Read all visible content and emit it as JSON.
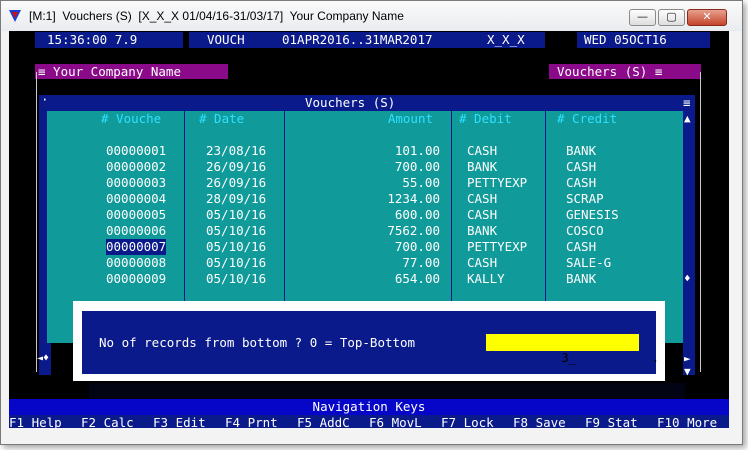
{
  "window": {
    "title": "[M:1]  Vouchers (S)  [X_X_X 01/04/16-31/03/17]  Your Company Name",
    "minimize_glyph": "—",
    "maximize_glyph": "▢",
    "close_glyph": "✕"
  },
  "status_bar": {
    "clock": "15:36:00 7.9",
    "module": "VOUCH",
    "period": "01APR2016..31MAR2017",
    "code": "X_X_X",
    "date": "WED 05OCT16"
  },
  "company_tab": "≡ Your Company Name",
  "view_tab": "Vouchers (S) ≡",
  "grid": {
    "title": "Vouchers (S)",
    "left_marker": "·",
    "right_marker": "≡",
    "columns": [
      "# Vouche",
      "# Date",
      "Amount",
      "# Debit",
      "# Credit"
    ],
    "rows": [
      [
        "00000001",
        "23/08/16",
        "101.00",
        "CASH",
        "BANK"
      ],
      [
        "00000002",
        "26/09/16",
        "700.00",
        "BANK",
        "CASH"
      ],
      [
        "00000003",
        "26/09/16",
        "55.00",
        "PETTYEXP",
        "CASH"
      ],
      [
        "00000004",
        "28/09/16",
        "1234.00",
        "CASH",
        "SCRAP"
      ],
      [
        "00000005",
        "05/10/16",
        "600.00",
        "CASH",
        "GENESIS"
      ],
      [
        "00000006",
        "05/10/16",
        "7562.00",
        "BANK",
        "COSCO"
      ],
      [
        "00000007",
        "05/10/16",
        "700.00",
        "PETTYEXP",
        "CASH"
      ],
      [
        "00000008",
        "05/10/16",
        "77.00",
        "CASH",
        "SALE-G"
      ],
      [
        "00000009",
        "05/10/16",
        "654.00",
        "KALLY",
        "BANK"
      ]
    ],
    "selected_row": 6,
    "scroll_up": "▲",
    "scroll_down": "▼",
    "scroll_thumb": "♦",
    "scroll_left": "◄♦",
    "scroll_right": "►"
  },
  "dialog": {
    "prompt": "No of records from bottom ? 0 = Top-Bottom",
    "input_value": "3",
    "input_mask": "_          ."
  },
  "nav": {
    "title": "Navigation Keys",
    "keys": [
      {
        "key": "F1",
        "label": "Help"
      },
      {
        "key": "F2",
        "label": "Calc"
      },
      {
        "key": "F3",
        "label": "Edit"
      },
      {
        "key": "F4",
        "label": "Prnt"
      },
      {
        "key": "F5",
        "label": "AddC"
      },
      {
        "key": "F6",
        "label": "MovL"
      },
      {
        "key": "F7",
        "label": "Lock"
      },
      {
        "key": "F8",
        "label": "Save"
      },
      {
        "key": "F9",
        "label": "Stat"
      },
      {
        "key": "F10",
        "label": "More"
      }
    ]
  },
  "colors": {
    "navy": "#0a1a8a",
    "teal": "#119a9a",
    "purple": "#8a0a8a",
    "header_text": "#2ee0ff",
    "input_bg": "#ffff00",
    "nav_band": "#0606c8"
  }
}
